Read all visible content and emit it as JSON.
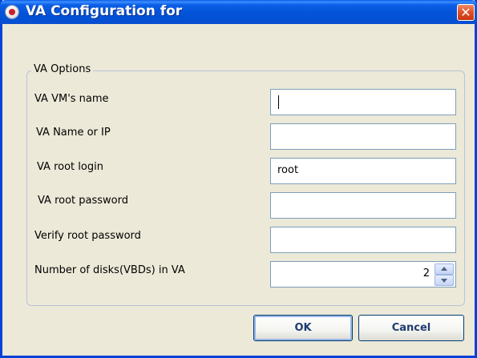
{
  "window": {
    "title": "VA Configuration for",
    "close_icon": "close-icon",
    "app_icon": "app-icon"
  },
  "group": {
    "legend": "VA Options"
  },
  "fields": {
    "vm_name": {
      "label": "VA VM's name",
      "value": ""
    },
    "name_or_ip": {
      "label": "VA Name or IP",
      "value": ""
    },
    "root_login": {
      "label": "VA root login",
      "value": "root"
    },
    "root_password": {
      "label": "VA root password",
      "value": ""
    },
    "verify_password": {
      "label": "Verify root password",
      "value": ""
    },
    "num_disks": {
      "label": "Number of disks(VBDs) in VA",
      "value": "2"
    }
  },
  "buttons": {
    "ok": "OK",
    "cancel": "Cancel"
  },
  "colors": {
    "titlebar": "#0453d8",
    "window_bg": "#ece9d8",
    "close": "#e0512a"
  }
}
